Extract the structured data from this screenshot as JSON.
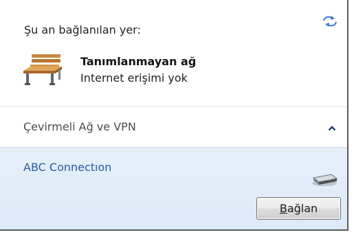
{
  "current_connection": {
    "label": "Şu an bağlanılan yer:",
    "network_name": "Tanımlanmayan ağ",
    "network_status": "Internet erişimi yok",
    "icons": [
      "refresh-icon",
      "bench-icon"
    ]
  },
  "dialup_section": {
    "label": "Çevirmeli Ağ ve VPN",
    "expanded": true,
    "icon": "chevron-up-icon"
  },
  "connections": [
    {
      "name": "ABC Connectıon",
      "icon": "modem-icon",
      "button": {
        "mnemonic": "B",
        "rest": "ağlan"
      }
    }
  ],
  "colors": {
    "selected_background": "#e6f0fa",
    "connection_text": "#2b5aa0",
    "border": "#5a5a5a"
  }
}
